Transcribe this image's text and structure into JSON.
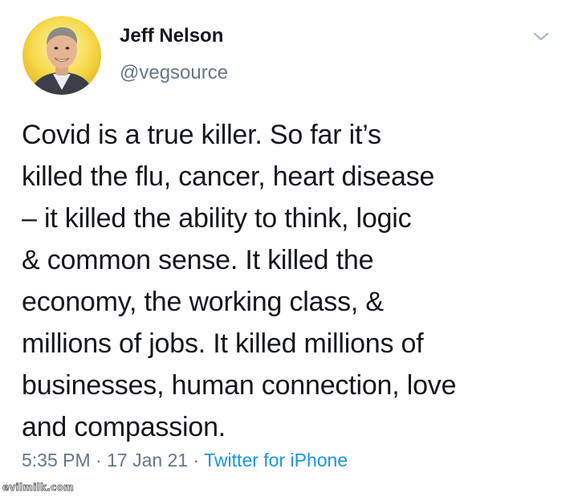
{
  "tweet": {
    "author": {
      "display_name": "Jeff Nelson",
      "handle": "@vegsource",
      "avatar_icon": "profile-photo"
    },
    "menu_icon": "chevron-down-icon",
    "text_lines": [
      "Covid is a true killer. So far it’s",
      "killed the flu, cancer, heart disease",
      "– it killed the ability to think, logic",
      "& common sense. It killed the",
      "economy, the working class, &",
      "millions of jobs. It killed millions of",
      "businesses, human connection, love",
      "and compassion."
    ],
    "time": "5:35 PM",
    "separator": " · ",
    "date": "17 Jan 21",
    "source": "Twitter for iPhone"
  },
  "watermark": "evilmilk.com",
  "colors": {
    "text": "#14171a",
    "secondary": "#657786",
    "link": "#1b95e0",
    "background": "#ffffff"
  }
}
